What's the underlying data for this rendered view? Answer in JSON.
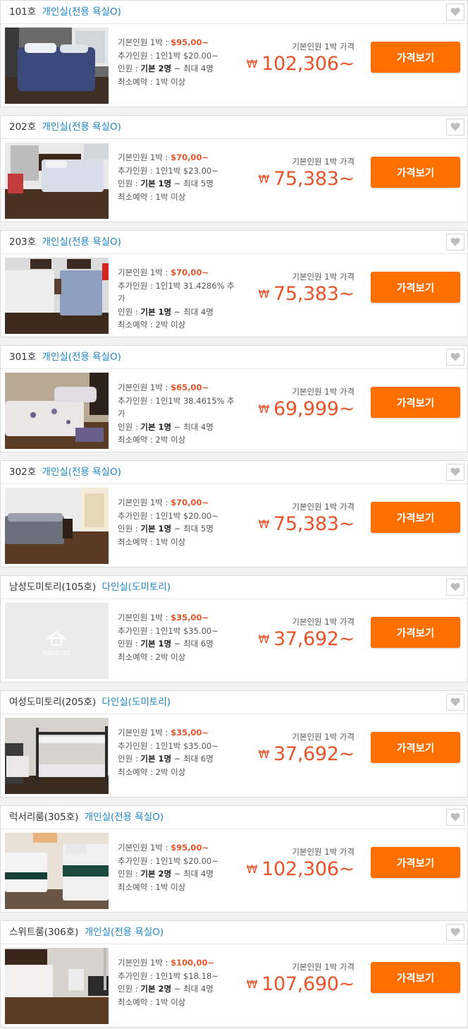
{
  "icons": {
    "favorite": "heart-icon",
    "placeholder": "hanintel-logo"
  },
  "colors": {
    "accent": "#ff6f00",
    "price": "#e8542a",
    "type_link": "#1a87c8"
  },
  "labels": {
    "base_price_prefix": "기본인원 1박 : ",
    "extra_prefix": "추가인원 : ",
    "capacity_prefix": "인원 : ",
    "capacity_middle": " ~ ",
    "min_stay_prefix": "최소예약 : ",
    "price_label": "기본인원 1박 가격",
    "currency": "₩",
    "price_suffix": "~",
    "button": "가격보기",
    "placeholder_logo": "hanintel"
  },
  "rooms": [
    {
      "name": "101호",
      "type": "개인실(전용 욕실O)",
      "base_price": "$95,00~",
      "extra": "1인1박 $20.00~",
      "capacity_base": "기본 2명",
      "capacity_max": "최대 4명",
      "min_stay": "1박 이상",
      "price": "102,306",
      "photo": "bedroom-navy"
    },
    {
      "name": "202호",
      "type": "개인실(전용 욕실O)",
      "base_price": "$70,00~",
      "extra": "1인1박 $23.00~",
      "capacity_base": "기본 1명",
      "capacity_max": "최대 5명",
      "min_stay": "1박 이상",
      "price": "75,383",
      "photo": "bedroom-window"
    },
    {
      "name": "203호",
      "type": "개인실(전용 욕실O)",
      "base_price": "$70,00~",
      "extra": "1인1박 31.4286% 추가",
      "capacity_base": "기본 1명",
      "capacity_max": "최대 4명",
      "min_stay": "2박 이상",
      "price": "75,383",
      "photo": "twin-beds"
    },
    {
      "name": "301호",
      "type": "개인실(전용 욕실O)",
      "base_price": "$65,00~",
      "extra": "1인1박 38.4615% 추가",
      "capacity_base": "기본 1명",
      "capacity_max": "최대 4명",
      "min_stay": "2박 이상",
      "price": "69,999",
      "photo": "floral-beds"
    },
    {
      "name": "302호",
      "type": "개인실(전용 욕실O)",
      "base_price": "$70,00~",
      "extra": "1인1박 $20.00~",
      "capacity_base": "기본 1명",
      "capacity_max": "최대 5명",
      "min_stay": "1박 이상",
      "price": "75,383",
      "photo": "bedroom-door"
    },
    {
      "name": "남성도미토리(105호)",
      "type": "다인실(도미토리)",
      "base_price": "$35,00~",
      "extra": "1인1박 $35.00~",
      "capacity_base": "기본 1명",
      "capacity_max": "최대 6명",
      "min_stay": "2박 이상",
      "price": "37,692",
      "photo": "placeholder"
    },
    {
      "name": "여성도미토리(205호)",
      "type": "다인실(도미토리)",
      "base_price": "$35,00~",
      "extra": "1인1박 $35.00~",
      "capacity_base": "기본 1명",
      "capacity_max": "최대 6명",
      "min_stay": "2박 이상",
      "price": "37,692",
      "photo": "bunk-beds"
    },
    {
      "name": "럭서리룸(305호)",
      "type": "개인실(전용 욕실O)",
      "base_price": "$95,00~",
      "extra": "1인1박 $20.00~",
      "capacity_base": "기본 2명",
      "capacity_max": "최대 4명",
      "min_stay": "1박 이상",
      "price": "102,306",
      "photo": "luxury-twin"
    },
    {
      "name": "스위트룸(306호)",
      "type": "개인실(전용 욕실O)",
      "base_price": "$100,00~",
      "extra": "1인1박 $18.18~",
      "capacity_base": "기본 2명",
      "capacity_max": "최대 4명",
      "min_stay": "1박 이상",
      "price": "107,690",
      "photo": "suite"
    }
  ]
}
